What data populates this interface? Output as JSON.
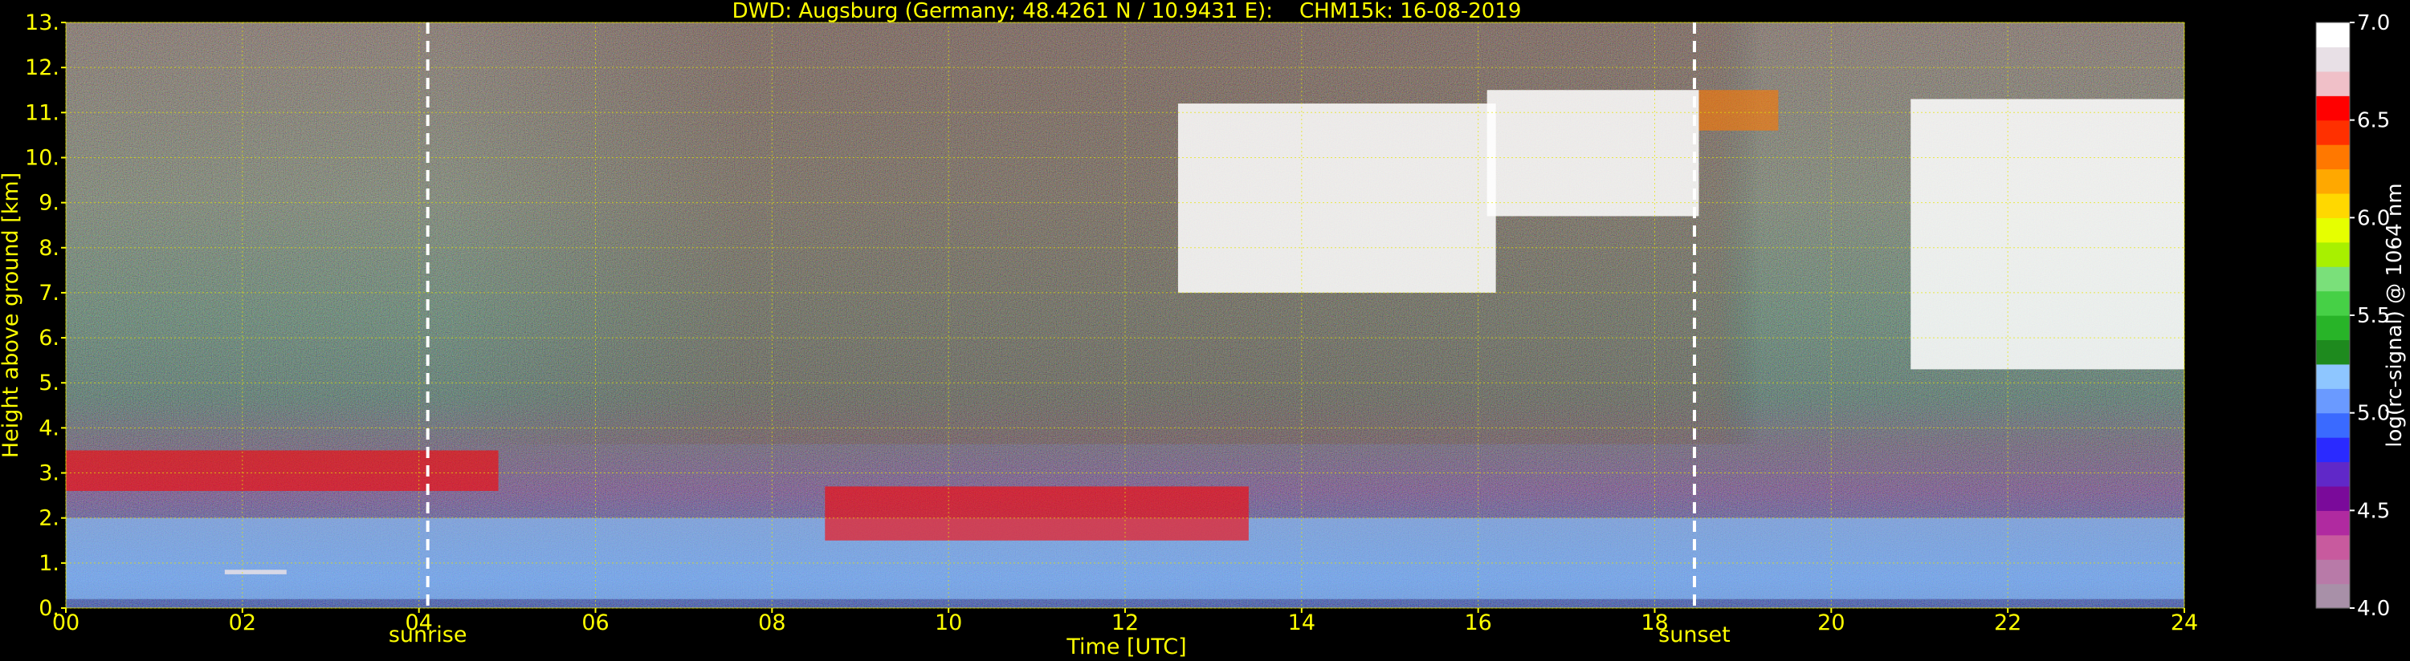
{
  "chart_data": {
    "type": "heatmap",
    "title": "DWD: Augsburg (Germany; 48.4261 N / 10.9431 E):    CHM15k: 16-08-2019",
    "xlabel": "Time [UTC]",
    "ylabel": "Height above ground [km]",
    "xlim": [
      0,
      24
    ],
    "ylim": [
      0,
      13
    ],
    "x_ticks": [
      "00",
      "02",
      "04",
      "06",
      "08",
      "10",
      "12",
      "14",
      "16",
      "18",
      "20",
      "22",
      "24"
    ],
    "y_ticks": [
      "0.",
      "1.",
      "2.",
      "3.",
      "4.",
      "5.",
      "6.",
      "7.",
      "8.",
      "9.",
      "10.",
      "11.",
      "12.",
      "13."
    ],
    "grid": true,
    "markers": [
      {
        "label": "sunrise",
        "time": 4.1
      },
      {
        "label": "sunset",
        "time": 18.45
      }
    ],
    "colorbar": {
      "label": "log(rc-signal) @ 1064 nm",
      "min": 4.0,
      "max": 7.0,
      "ticks": [
        "4.0",
        "4.5",
        "5.0",
        "5.5",
        "6.0",
        "6.5",
        "7.0"
      ],
      "colors": [
        "#a890a8",
        "#b87aa8",
        "#c85a9e",
        "#b02aa0",
        "#7a0a9a",
        "#6028c8",
        "#2a2aff",
        "#3a6aff",
        "#6a9aff",
        "#8ec6ff",
        "#1e8a1e",
        "#28b428",
        "#46d046",
        "#7ae07a",
        "#a8f000",
        "#e6ff00",
        "#ffd800",
        "#ffa800",
        "#ff7800",
        "#ff3000",
        "#ff0000",
        "#f0c0c8",
        "#e8e0e6",
        "#ffffff"
      ]
    },
    "features": [
      {
        "name": "boundary-layer-aerosol",
        "time_start": 0,
        "time_end": 24,
        "height_min": 0.2,
        "height_max": 2.0,
        "level": 5.2
      },
      {
        "name": "residual-layer-top",
        "time_start": 0,
        "time_end": 4.9,
        "height_min": 2.6,
        "height_max": 3.5,
        "level": 6.5
      },
      {
        "name": "low-cloud",
        "time_start": 1.8,
        "time_end": 2.5,
        "height_min": 0.75,
        "height_max": 0.85,
        "level": 6.8
      },
      {
        "name": "convective-cloud-tops",
        "time_start": 8.6,
        "time_end": 13.4,
        "height_min": 1.5,
        "height_max": 2.7,
        "level": 6.5
      },
      {
        "name": "cirrus-1",
        "time_start": 12.6,
        "time_end": 16.2,
        "height_min": 7.0,
        "height_max": 11.2,
        "level": 6.9
      },
      {
        "name": "cirrus-2",
        "time_start": 16.1,
        "time_end": 18.5,
        "height_min": 8.7,
        "height_max": 11.5,
        "level": 6.9
      },
      {
        "name": "cirrus-3",
        "time_start": 18.5,
        "time_end": 19.4,
        "height_min": 10.6,
        "height_max": 11.5,
        "level": 6.3
      },
      {
        "name": "cirrus-4",
        "time_start": 20.9,
        "time_end": 24,
        "height_min": 5.3,
        "height_max": 11.3,
        "level": 6.9
      }
    ]
  }
}
